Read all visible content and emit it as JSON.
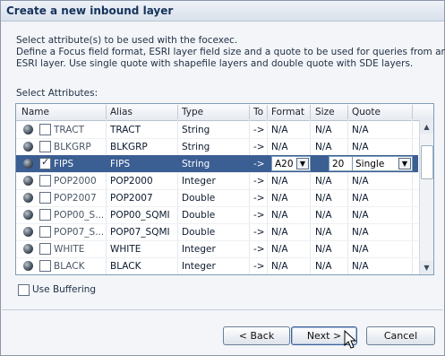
{
  "dialog": {
    "title": "Create a new inbound layer",
    "instructions": [
      "Select attribute(s) to be used with the focexec.",
      "Define a Focus field format, ESRI layer field size and a quote to be used for queries from an",
      "ESRI layer. Use single quote with shapefile layers and double quote with SDE layers."
    ],
    "attributes_label": "Select Attributes:",
    "columns": [
      "Name",
      "Alias",
      "Type",
      "To",
      "Format",
      "Size",
      "Quote"
    ],
    "rows": [
      {
        "name": "TRACT",
        "alias": "TRACT",
        "type": "String",
        "to": "->",
        "format": "N/A",
        "size": "N/A",
        "quote": "N/A",
        "checked": false
      },
      {
        "name": "BLKGRP",
        "alias": "BLKGRP",
        "type": "String",
        "to": "->",
        "format": "N/A",
        "size": "N/A",
        "quote": "N/A",
        "checked": false
      },
      {
        "name": "FIPS",
        "alias": "FIPS",
        "type": "String",
        "to": "->",
        "format": "A20",
        "size": "20",
        "quote": "Single",
        "checked": true
      },
      {
        "name": "POP2000",
        "alias": "POP2000",
        "type": "Integer",
        "to": "->",
        "format": "N/A",
        "size": "N/A",
        "quote": "N/A",
        "checked": false
      },
      {
        "name": "POP2007",
        "alias": "POP2007",
        "type": "Double",
        "to": "->",
        "format": "N/A",
        "size": "N/A",
        "quote": "N/A",
        "checked": false
      },
      {
        "name": "POP00_S...",
        "alias": "POP00_SQMI",
        "type": "Double",
        "to": "->",
        "format": "N/A",
        "size": "N/A",
        "quote": "N/A",
        "checked": false
      },
      {
        "name": "POP07_S...",
        "alias": "POP07_SQMI",
        "type": "Double",
        "to": "->",
        "format": "N/A",
        "size": "N/A",
        "quote": "N/A",
        "checked": false
      },
      {
        "name": "WHITE",
        "alias": "WHITE",
        "type": "Integer",
        "to": "->",
        "format": "N/A",
        "size": "N/A",
        "quote": "N/A",
        "checked": false
      },
      {
        "name": "BLACK",
        "alias": "BLACK",
        "type": "Integer",
        "to": "->",
        "format": "N/A",
        "size": "N/A",
        "quote": "N/A",
        "checked": false
      }
    ],
    "use_buffering_label": "Use Buffering",
    "use_buffering_checked": false,
    "buttons": {
      "back": "< Back",
      "next": "Next >",
      "cancel": "Cancel"
    },
    "colors": {
      "selected_row": "#3b5e93",
      "title_text": "#15325c"
    }
  }
}
